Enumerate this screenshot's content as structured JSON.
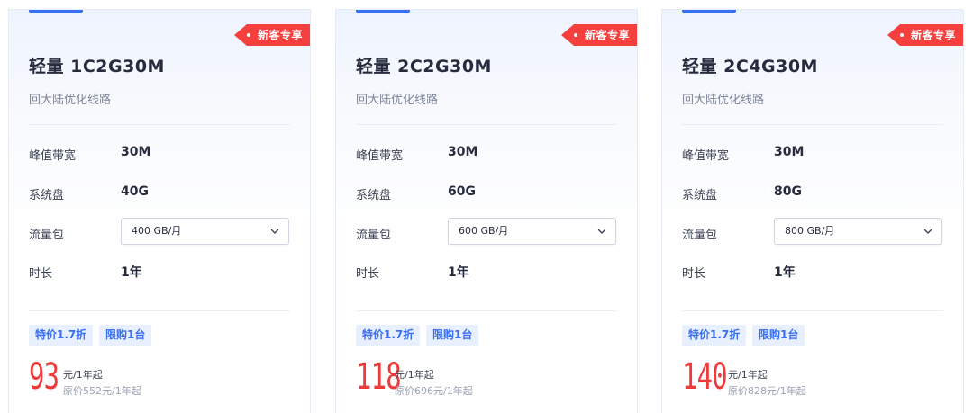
{
  "colors": {
    "accent": "#3a6ff2",
    "badge": "#f5403d",
    "price": "#f03a3a"
  },
  "cards": [
    {
      "badge": "新客专享",
      "title": "轻量 1C2G30M",
      "subtitle": "回大陆优化线路",
      "bandwidth_label": "峰值带宽",
      "bandwidth_value": "30M",
      "disk_label": "系统盘",
      "disk_value": "40G",
      "traffic_label": "流量包",
      "traffic_selected": "400 GB/月",
      "duration_label": "时长",
      "duration_value": "1年",
      "tag_discount": "特价1.7折",
      "tag_limit": "限购1台",
      "price": "93",
      "price_unit": "元/1年起",
      "original_price": "原价552元/1年起"
    },
    {
      "badge": "新客专享",
      "title": "轻量 2C2G30M",
      "subtitle": "回大陆优化线路",
      "bandwidth_label": "峰值带宽",
      "bandwidth_value": "30M",
      "disk_label": "系统盘",
      "disk_value": "60G",
      "traffic_label": "流量包",
      "traffic_selected": "600 GB/月",
      "duration_label": "时长",
      "duration_value": "1年",
      "tag_discount": "特价1.7折",
      "tag_limit": "限购1台",
      "price": "118",
      "price_unit": "元/1年起",
      "original_price": "原价696元/1年起"
    },
    {
      "badge": "新客专享",
      "title": "轻量 2C4G30M",
      "subtitle": "回大陆优化线路",
      "bandwidth_label": "峰值带宽",
      "bandwidth_value": "30M",
      "disk_label": "系统盘",
      "disk_value": "80G",
      "traffic_label": "流量包",
      "traffic_selected": "800 GB/月",
      "duration_label": "时长",
      "duration_value": "1年",
      "tag_discount": "特价1.7折",
      "tag_limit": "限购1台",
      "price": "140",
      "price_unit": "元/1年起",
      "original_price": "原价828元/1年起"
    }
  ]
}
